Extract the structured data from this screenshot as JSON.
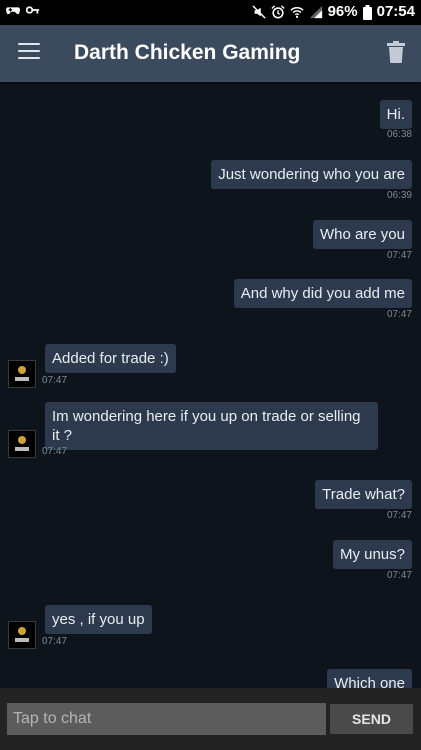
{
  "status_bar": {
    "battery": "96%",
    "time": "07:54",
    "icons": [
      "gamepad-icon",
      "key-icon",
      "mute-icon",
      "alarm-icon",
      "wifi-icon",
      "signal-icon",
      "battery-icon"
    ]
  },
  "header": {
    "title": "Darth Chicken Gaming",
    "menu_icon": "menu-icon",
    "delete_icon": "trash-icon"
  },
  "messages": [
    {
      "dir": "out",
      "text": "Hi.",
      "time": "06:38"
    },
    {
      "dir": "out",
      "text": "Just wondering who you are",
      "time": "06:39"
    },
    {
      "dir": "out",
      "text": "Who are you",
      "time": "07:47"
    },
    {
      "dir": "out",
      "text": "And why did you add me",
      "time": "07:47"
    },
    {
      "dir": "in",
      "text": "Added for trade :)",
      "time": "07:47"
    },
    {
      "dir": "in",
      "text": "Im wondering here if you up on trade or selling it ?",
      "time": "07:47"
    },
    {
      "dir": "out",
      "text": "Trade what?",
      "time": "07:47"
    },
    {
      "dir": "out",
      "text": "My unus?",
      "time": "07:47"
    },
    {
      "dir": "in",
      "text": "yes , if you up",
      "time": "07:47"
    },
    {
      "dir": "out",
      "text": "Which one",
      "time": ""
    }
  ],
  "composer": {
    "placeholder": "Tap to chat",
    "send_label": "SEND"
  },
  "colors": {
    "background": "#0e141b",
    "appbar": "#3b4a5c",
    "bubble": "#2d3a4e",
    "input_bar": "#232323"
  }
}
